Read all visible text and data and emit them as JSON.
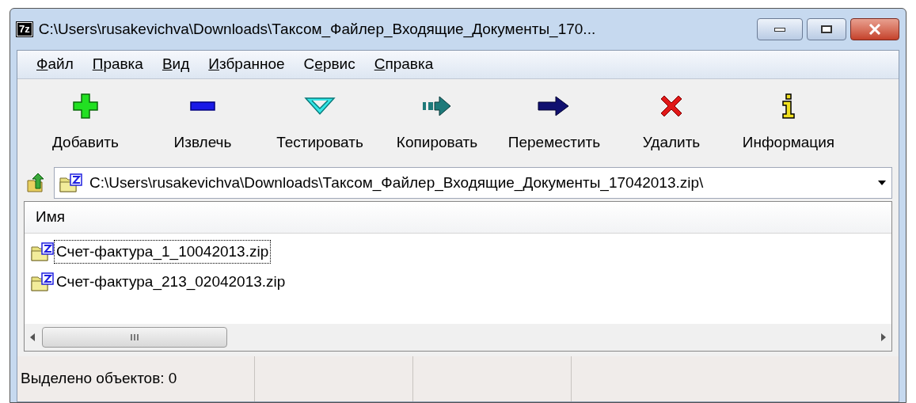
{
  "window": {
    "title": "C:\\Users\\rusakevichva\\Downloads\\Таксом_Файлер_Входящие_Документы_170...",
    "app_icon": "7z"
  },
  "menu": [
    {
      "key": "Ф",
      "post": "айл"
    },
    {
      "key": "П",
      "post": "равка"
    },
    {
      "key": "В",
      "post": "ид"
    },
    {
      "key": "И",
      "post": "збранное"
    },
    {
      "pre": "С",
      "key": "е",
      "post": "рвис"
    },
    {
      "key": "С",
      "post": "правка"
    }
  ],
  "toolbar": [
    {
      "kind": "add",
      "label": "Добавить"
    },
    {
      "kind": "extract",
      "label": "Извлечь"
    },
    {
      "kind": "test",
      "label": "Тестировать"
    },
    {
      "kind": "copy",
      "label": "Копировать"
    },
    {
      "kind": "move",
      "label": "Переместить"
    },
    {
      "kind": "delete",
      "label": "Удалить"
    },
    {
      "kind": "info",
      "label": "Информация"
    }
  ],
  "address": {
    "value": "C:\\Users\\rusakevichva\\Downloads\\Таксом_Файлер_Входящие_Документы_17042013.zip\\"
  },
  "table": {
    "columns": [
      "Имя"
    ],
    "rows": [
      {
        "name": "Счет-фактура_1_10042013.zip",
        "focused": true
      },
      {
        "name": "Счет-фактура_213_02042013.zip",
        "focused": false
      }
    ]
  },
  "status_bar": {
    "text": "Выделено объектов: 0"
  }
}
